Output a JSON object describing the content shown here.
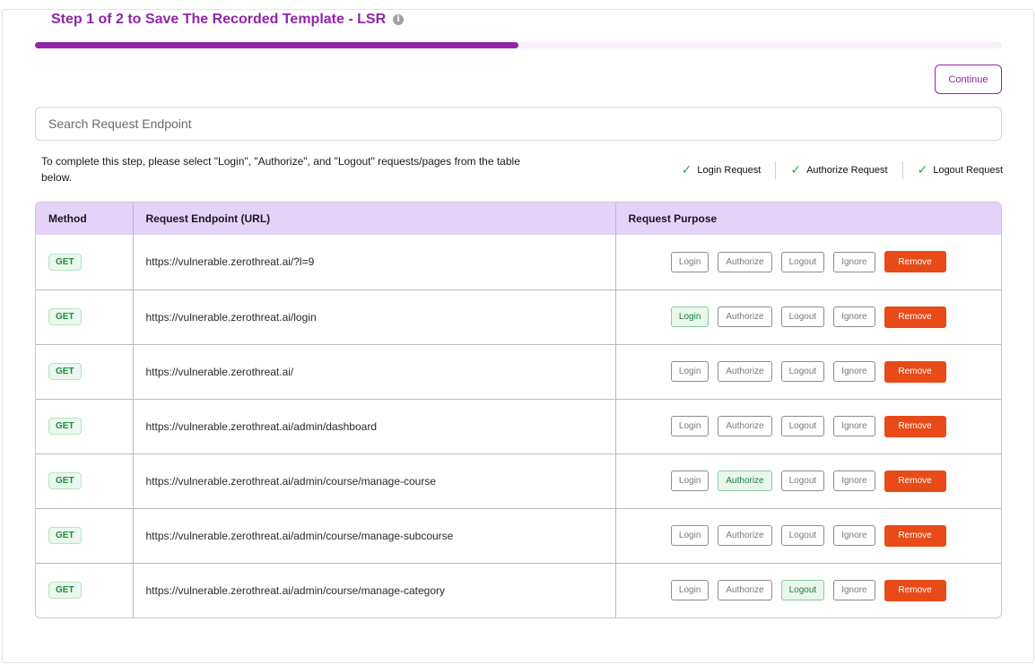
{
  "header": {
    "title": "Step 1 of 2 to Save The Recorded Template - LSR",
    "info_icon": "i",
    "progress_fraction": 0.5
  },
  "actions": {
    "continue_label": "Continue"
  },
  "search": {
    "placeholder": "Search Request Endpoint",
    "value": ""
  },
  "instructions": "To complete this step, please select \"Login\", \"Authorize\", and \"Logout\" requests/pages from the table below.",
  "legend": [
    {
      "icon": "check-icon",
      "label": "Login Request"
    },
    {
      "icon": "check-icon",
      "label": "Authorize Request"
    },
    {
      "icon": "check-icon",
      "label": "Logout Request"
    }
  ],
  "table": {
    "columns": [
      "Method",
      "Request Endpoint (URL)",
      "Request Purpose"
    ],
    "purpose_options": [
      "Login",
      "Authorize",
      "Logout",
      "Ignore"
    ],
    "remove_label": "Remove",
    "rows": [
      {
        "method": "GET",
        "url": "https://vulnerable.zerothreat.ai/?l=9",
        "selected": ""
      },
      {
        "method": "GET",
        "url": "https://vulnerable.zerothreat.ai/login",
        "selected": "Login"
      },
      {
        "method": "GET",
        "url": "https://vulnerable.zerothreat.ai/",
        "selected": ""
      },
      {
        "method": "GET",
        "url": "https://vulnerable.zerothreat.ai/admin/dashboard",
        "selected": ""
      },
      {
        "method": "GET",
        "url": "https://vulnerable.zerothreat.ai/admin/course/manage-course",
        "selected": "Authorize"
      },
      {
        "method": "GET",
        "url": "https://vulnerable.zerothreat.ai/admin/course/manage-subcourse",
        "selected": ""
      },
      {
        "method": "GET",
        "url": "https://vulnerable.zerothreat.ai/admin/course/manage-category",
        "selected": "Logout"
      }
    ]
  },
  "colors": {
    "accent": "#9126a8",
    "header_bg": "#e5d2f9",
    "remove": "#e84b17",
    "success": "#2fa84f"
  }
}
